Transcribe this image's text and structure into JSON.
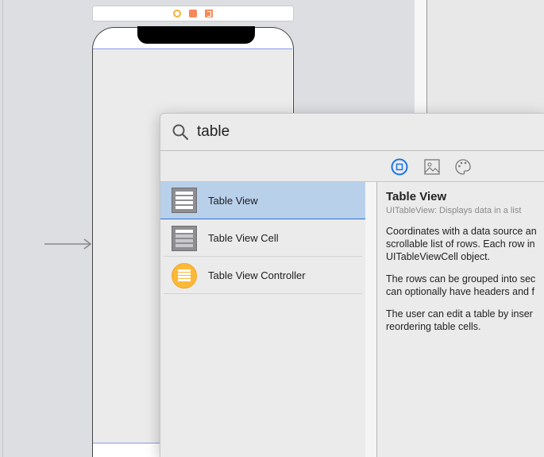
{
  "search": {
    "value": "table",
    "placeholder": ""
  },
  "filters": [
    {
      "name": "objects"
    },
    {
      "name": "media"
    },
    {
      "name": "colors"
    }
  ],
  "list": [
    {
      "label": "Table View",
      "selected": true
    },
    {
      "label": "Table View Cell",
      "selected": false
    },
    {
      "label": "Table View Controller",
      "selected": false
    }
  ],
  "detail": {
    "title": "Table View",
    "subtitle": "UITableView: Displays data in a list",
    "paragraphs": [
      [
        "Coordinates with a data source an",
        "scrollable list of rows. Each row in",
        "UITableViewCell object."
      ],
      [
        "The rows can be grouped into sec",
        "can optionally have headers and f"
      ],
      [
        "The user can edit a table by inser",
        "reordering table cells."
      ]
    ]
  },
  "colors": {
    "selection": "#b8d0ea",
    "accent": "#1a73e8",
    "controller_icon": "#fbb938"
  }
}
